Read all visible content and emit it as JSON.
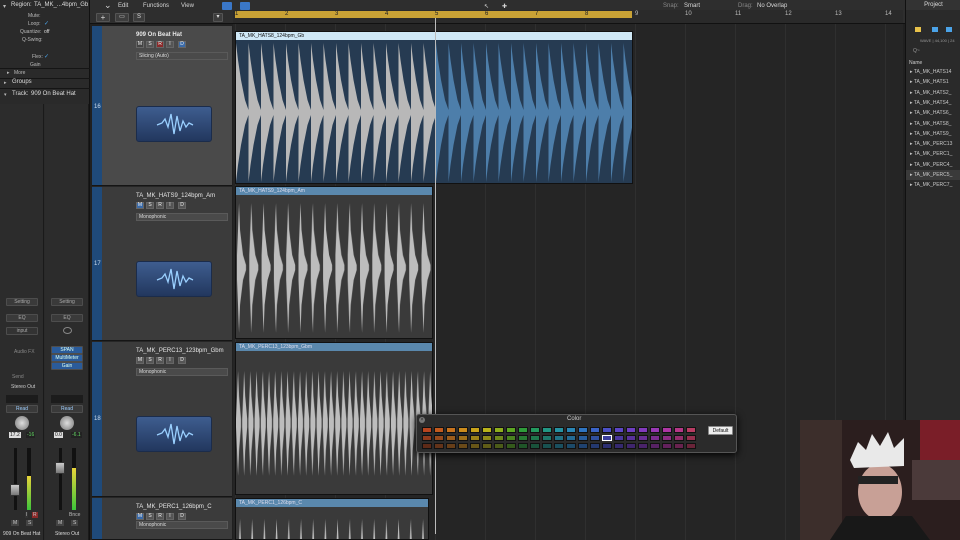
{
  "toolbar": {
    "edit": "Edit",
    "functions": "Functions",
    "view": "View",
    "snap_label": "Snap:",
    "snap_value": "Smart",
    "drag_label": "Drag:",
    "drag_value": "No Overlap",
    "add_track": "+",
    "scissors": "S"
  },
  "inspector": {
    "region_label": "Region:",
    "region_name": "TA_MK_...4bpm_Gb",
    "rows": [
      "Mute:",
      "Loop:",
      "Quantize:",
      "Q-Swing:",
      "Flex:",
      "Gain"
    ],
    "quantize_value": "off",
    "more": "More",
    "groups": "Groups",
    "track_label": "Track:",
    "track_name": "909 On Beat Hat"
  },
  "strips": [
    {
      "setting": "Setting",
      "eq": "EQ",
      "input": "input",
      "audio_fx": "Audio FX",
      "plugins": [],
      "send": "Send",
      "output": "Stereo Out",
      "read": "Read",
      "vol": "17.2",
      "pan": "-16",
      "m": "M",
      "s": "S",
      "i": "I",
      "r": "R",
      "name": "909 On Beat Hat"
    },
    {
      "setting": "Setting",
      "eq": "EQ",
      "input": "",
      "audio_fx": "",
      "plugins": [
        "SPAN",
        "MultiMeter",
        "Gain"
      ],
      "send": "",
      "output": "",
      "read": "Read",
      "vol": "0.0",
      "pan": "-6.1",
      "m": "M",
      "s": "S",
      "i": "",
      "r": "",
      "bnce": "Bnce",
      "name": "Stereo Out"
    }
  ],
  "ruler": [
    "1",
    "2",
    "3",
    "4",
    "5",
    "6",
    "7",
    "8",
    "9",
    "10",
    "11",
    "12",
    "13",
    "14"
  ],
  "tracks": [
    {
      "num": "16",
      "name": "909 On Beat Hat",
      "mode": "Slicing (Auto)",
      "region": "TA_MK_HATS8_124bpm_Gb",
      "btns": [
        "M",
        "S",
        "R",
        "I",
        "D"
      ]
    },
    {
      "num": "17",
      "name": "TA_MK_HATS9_124bpm_Am",
      "mode": "Monophonic",
      "region": "TA_MK_HATS9_124bpm_Am",
      "btns": [
        "M",
        "S",
        "R",
        "I",
        "D"
      ]
    },
    {
      "num": "18",
      "name": "TA_MK_PERC13_123bpm_Gbm",
      "mode": "Monophonic",
      "region": "TA_MK_PERC13_123bpm_Gbm",
      "btns": [
        "M",
        "S",
        "R",
        "I",
        "D"
      ]
    },
    {
      "num": "",
      "name": "TA_MK_PERC1_126bpm_C",
      "mode": "Monophonic",
      "region": "TA_MK_PERC1_126bpm_C",
      "btns": [
        "M",
        "S",
        "R",
        "I",
        "D"
      ]
    }
  ],
  "project": {
    "title": "Project",
    "format": "WAVE | 44,100 | 24",
    "search_placeholder": "Q~",
    "name_header": "Name",
    "files": [
      "TA_MK_HATS14",
      "TA_MK_HATS1",
      "TA_MK_HATS2_",
      "TA_MK_HATS4_",
      "TA_MK_HATS6_",
      "TA_MK_HATS8_",
      "TA_MK_HATS9_",
      "TA_MK_PERC13",
      "TA_MK_PERC1_",
      "TA_MK_PERC4_",
      "TA_MK_PERC5_",
      "TA_MK_PERC7_"
    ]
  },
  "color_popup": {
    "title": "Color",
    "default_button": "Default",
    "colors": {
      "row1": [
        "#b8451f",
        "#c25a1e",
        "#c8731d",
        "#cc8c1c",
        "#c9a31a",
        "#b9b21a",
        "#8eae1c",
        "#5da722",
        "#2f9c3a",
        "#239a5e",
        "#229784",
        "#2592a2",
        "#2a86b6",
        "#2f75c2",
        "#3a63c7",
        "#4c51c8",
        "#5c46c6",
        "#6e3ec2",
        "#823abd",
        "#9838b4",
        "#ad36a4",
        "#b53787",
        "#b83c63"
      ],
      "row2": [
        "#8f3a1c",
        "#96491c",
        "#9b5c1b",
        "#9e6f1a",
        "#9b8219",
        "#8f8a19",
        "#6e871b",
        "#4a8220",
        "#287a33",
        "#1f784d",
        "#1e766a",
        "#217285",
        "#246a94",
        "#285d9d",
        "#304f9f",
        "#3d40a0",
        "#4a379e",
        "#59319b",
        "#692e96",
        "#7b2d8f",
        "#8c2c83",
        "#932d6c",
        "#95304f"
      ],
      "row3": [
        "#5e2a17",
        "#633319",
        "#673e18",
        "#6a4a18",
        "#685617",
        "#605c17",
        "#4b5b18",
        "#345a1b",
        "#1f5528",
        "#19533b",
        "#185150",
        "#1a4f5f",
        "#1c4a69",
        "#1f4270",
        "#243970",
        "#2c2f71",
        "#35296f",
        "#3f256d",
        "#4a236a",
        "#572265",
        "#63215d",
        "#68224e",
        "#6a2439"
      ]
    }
  },
  "colors": {
    "accent_blue": "#1f4a7a",
    "region_bar": "#c9a235",
    "selected_region": "#cfe8f6"
  }
}
